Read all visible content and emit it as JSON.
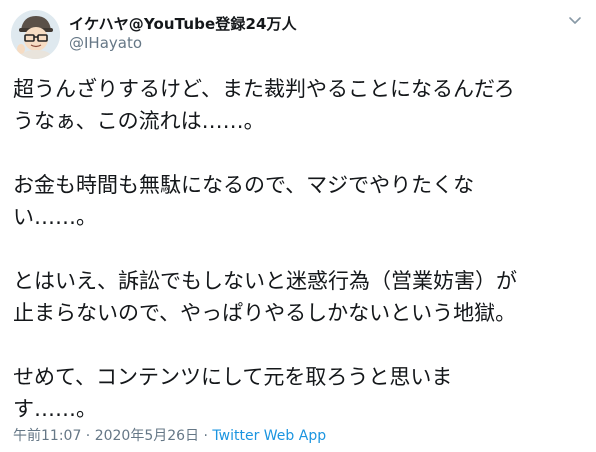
{
  "user": {
    "display_name": "イケハヤ@YouTube登録24万人",
    "handle": "@IHayato"
  },
  "tweet": {
    "paragraphs": [
      "超うんざりするけど、また裁判やることになるんだろ\nうなぁ、この流れは……。",
      "お金も時間も無駄になるので、マジでやりたくな\nい……。",
      "とはいえ、訴訟でもしないと迷惑行為（営業妨害）が\n止まらないので、やっぱりやるしかないという地獄。",
      "せめて、コンテンツにして元を取ろうと思いま\nす……。"
    ]
  },
  "meta": {
    "timestamp": "午前11:07 · 2020年5月26日",
    "separator": " · ",
    "source": "Twitter Web App"
  },
  "colors": {
    "text": "#14171a",
    "secondary": "#657786",
    "accent": "#1b95e0"
  },
  "icons": {
    "menu": "chevron-down-icon"
  }
}
